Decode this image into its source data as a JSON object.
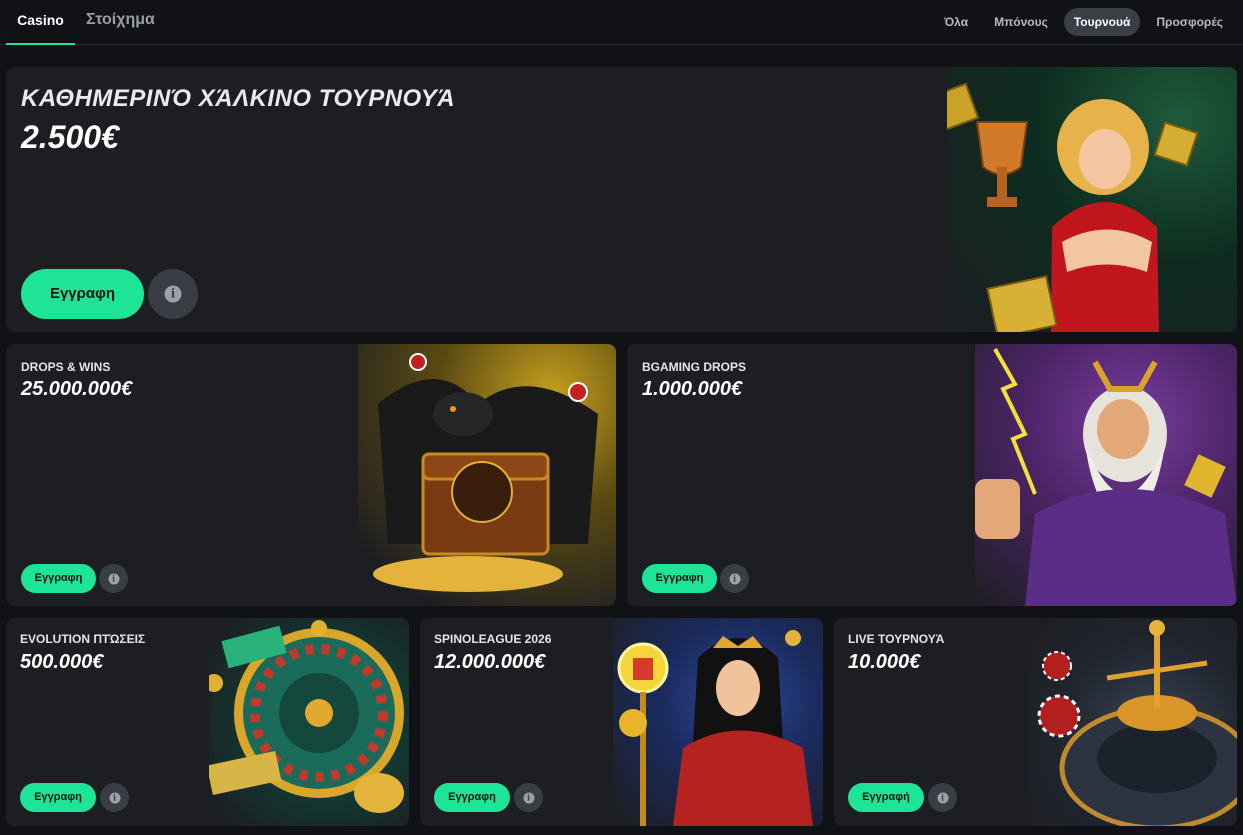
{
  "nav": {
    "tabs": [
      {
        "label": "Casino",
        "active": true
      },
      {
        "label": "Στοίχημα",
        "active": false
      }
    ],
    "filters": [
      {
        "label": "Όλα",
        "active": false
      },
      {
        "label": "Μπόνους",
        "active": false
      },
      {
        "label": "Τουρνουά",
        "active": true
      },
      {
        "label": "Προσφορές",
        "active": false
      }
    ]
  },
  "accent_color": "#1de497",
  "info_icon": "info-icon",
  "tournaments": [
    {
      "title": "ΚΑΘΗΜΕΡΙΝΌ ΧΆΛΚΙΝΟ ΤΟΥΡΝΟΥΆ",
      "prize": "2.500€",
      "register_label": "Εγγραφη",
      "art": "pinup-woman-trophy-icon"
    },
    {
      "title": "DROPS & WINS",
      "prize": "25.000.000€",
      "register_label": "Εγγραφη",
      "art": "dragon-treasure-chest-icon"
    },
    {
      "title": "BGAMING DROPS",
      "prize": "1.000.000€",
      "register_label": "Εγγραφη",
      "art": "zeus-lightning-icon"
    },
    {
      "title": "EVOLUTION ΠΤΏΣΕΙΣ",
      "prize": "500.000€",
      "register_label": "Εγγραφη",
      "art": "roulette-wheel-icon"
    },
    {
      "title": "SPINOLEAGUE 2026",
      "prize": "12.000.000€",
      "register_label": "Εγγραφη",
      "art": "warrior-woman-staff-icon"
    },
    {
      "title": "LIVE ΤΟΥΡΝΟΥΆ",
      "prize": "10.000€",
      "register_label": "Εγγραφή",
      "art": "roulette-bet-on-red-icon"
    }
  ]
}
